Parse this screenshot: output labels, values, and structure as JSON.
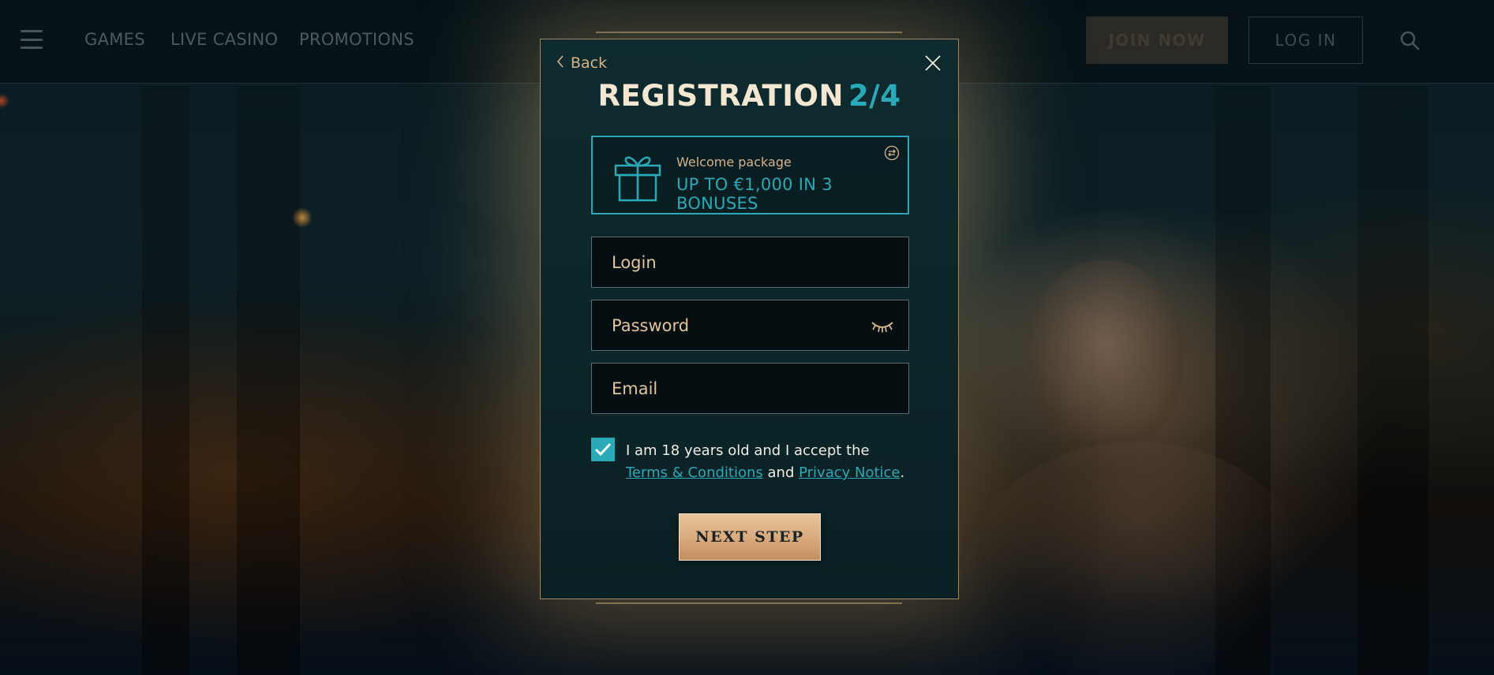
{
  "header": {
    "nav": [
      "GAMES",
      "LIVE CASINO",
      "PROMOTIONS"
    ],
    "join_label": "JOIN NOW",
    "login_label": "LOG IN"
  },
  "modal": {
    "back_label": "Back",
    "title": "REGISTRATION",
    "step": "2/4",
    "promo": {
      "label": "Welcome package",
      "value": "UP TO €1,000 IN 3 BONUSES"
    },
    "fields": {
      "login_placeholder": "Login",
      "password_placeholder": "Password",
      "email_placeholder": "Email"
    },
    "consent": {
      "checked": true,
      "text_before": "I am 18 years old and I accept the",
      "terms_link": "Terms & Conditions",
      "and": "and",
      "privacy_link": "Privacy Notice",
      "end": "."
    },
    "next_label": "NEXT STEP"
  },
  "colors": {
    "accent": "#2aa9b8",
    "gold": "#d6b28a",
    "modal_bg": "#0e2b2f"
  },
  "icons": [
    "menu-icon",
    "search-icon",
    "chevron-left-icon",
    "close-icon",
    "gift-icon",
    "swap-icon",
    "eye-closed-icon",
    "checkmark-icon"
  ]
}
